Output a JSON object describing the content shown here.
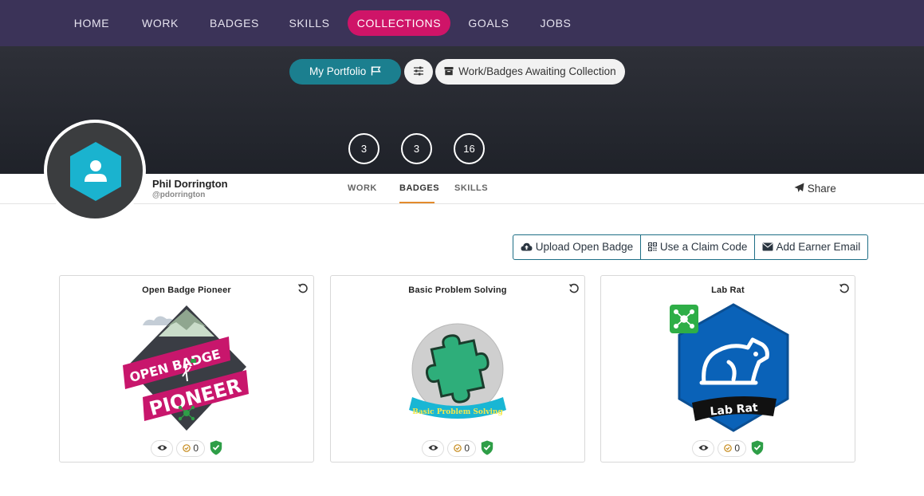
{
  "nav": {
    "items": [
      {
        "label": "HOME"
      },
      {
        "label": "WORK"
      },
      {
        "label": "BADGES"
      },
      {
        "label": "SKILLS"
      },
      {
        "label": "COLLECTIONS",
        "active": true
      },
      {
        "label": "GOALS"
      },
      {
        "label": "JOBS"
      }
    ]
  },
  "hero": {
    "portfolio_label": "My Portfolio",
    "awaiting_label": "Work/Badges Awaiting Collection",
    "counts": [
      "3",
      "3",
      "16"
    ]
  },
  "profile": {
    "name": "Phil Dorrington",
    "handle": "@pdorrington",
    "tabs": [
      {
        "label": "WORK"
      },
      {
        "label": "BADGES",
        "active": true
      },
      {
        "label": "SKILLS"
      }
    ],
    "share_label": "Share"
  },
  "actions": {
    "upload_label": "Upload Open Badge",
    "claim_label": "Use a Claim Code",
    "email_label": "Add Earner Email"
  },
  "badges": [
    {
      "title": "Open Badge Pioneer",
      "art_text_top": "OPEN BADGE",
      "art_text_bottom": "PIONEER",
      "endorsements": "0"
    },
    {
      "title": "Basic Problem Solving",
      "art_text": "Basic Problem Solving",
      "endorsements": "0"
    },
    {
      "title": "Lab Rat",
      "art_text": "Lab Rat",
      "endorsements": "0"
    }
  ],
  "colors": {
    "nav_bg": "#3b3358",
    "active_pink": "#cf1468",
    "teal": "#1b7f8f",
    "tab_underline": "#e38b2c",
    "verified_green": "#2e9e47"
  },
  "icons": [
    "flag-icon",
    "sliders-icon",
    "archive-icon",
    "user-icon",
    "paper-plane-icon",
    "cloud-upload-icon",
    "qr-code-icon",
    "envelope-icon",
    "refresh-icon",
    "eye-icon",
    "endorse-icon",
    "shield-check-icon"
  ]
}
